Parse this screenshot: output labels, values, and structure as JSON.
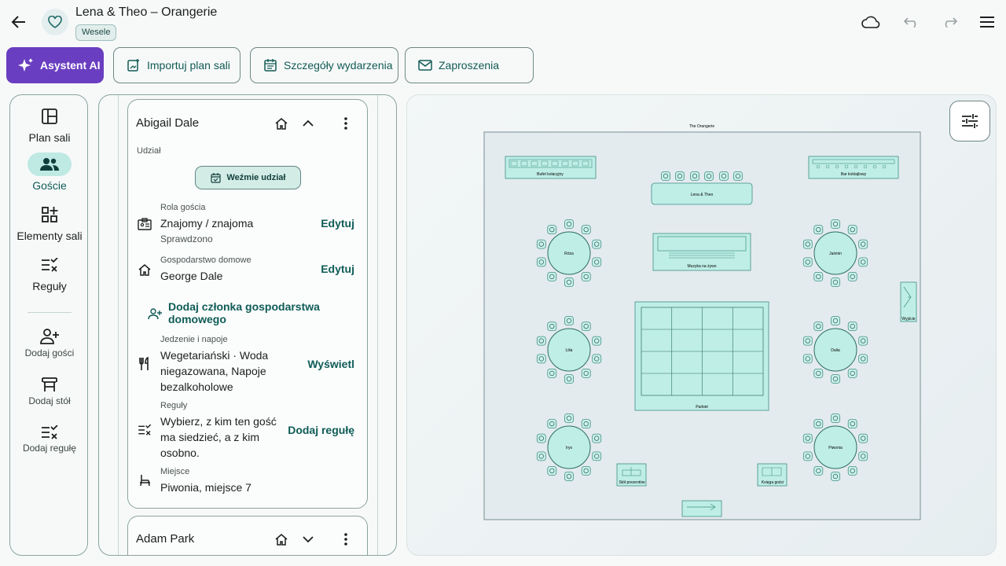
{
  "header": {
    "title": "Lena & Theo – Orangerie",
    "badge": "Wesele"
  },
  "toolbar": {
    "ai_label": "Asystent AI",
    "import_label": "Importuj plan sali",
    "details_label": "Szczegóły wydarzenia",
    "invites_label": "Zaproszenia"
  },
  "rail": {
    "nav": [
      {
        "label": "Plan sali",
        "icon": "layout-icon"
      },
      {
        "label": "Goście",
        "icon": "people-icon"
      },
      {
        "label": "Elementy sali",
        "icon": "widgets-icon"
      },
      {
        "label": "Reguły",
        "icon": "rules-icon"
      }
    ],
    "actions": [
      {
        "label": "Dodaj gości",
        "icon": "add-person-icon"
      },
      {
        "label": "Dodaj stół",
        "icon": "table-icon"
      },
      {
        "label": "Dodaj regułę",
        "icon": "rules-icon"
      }
    ]
  },
  "guest": {
    "name": "Abigail Dale",
    "participation_label": "Udział",
    "participation_btn": "Weźmie udział",
    "role_label": "Rola gościa",
    "role_value": "Znajomy / znajoma",
    "role_status": "Sprawdzono",
    "role_action": "Edytuj",
    "household_label": "Gospodarstwo domowe",
    "household_value": "George Dale",
    "household_action": "Edytuj",
    "add_member": "Dodaj członka gospodarstwa domowego",
    "food_label": "Jedzenie i napoje",
    "food_value": "Wegetariański · Woda niegazowana, Napoje bezalkoholowe",
    "food_action": "Wyświetl",
    "rules_label": "Reguły",
    "rules_value": "Wybierz, z kim ten gość ma siedzieć, a z kim osobno.",
    "rules_action": "Dodaj regułę",
    "seat_label": "Miejsce",
    "seat_value": "Piwonia, miejsce 7"
  },
  "guest2": {
    "name": "Adam Park"
  },
  "map": {
    "venue": "The Orangerie",
    "cake_table": "Bufet kolacyjny",
    "head_table": "Lena & Theo",
    "bar": "Bar koktajlowy",
    "music": "Muzyka na żywo",
    "dance": "Parkiet",
    "exit": "Wyjście",
    "gifts": "Stół prezentów",
    "guestbook": "Księga gości",
    "tables": [
      "Róża",
      "Jaśmin",
      "Lilia",
      "Dalia",
      "Irys",
      "Piwonia"
    ]
  },
  "colors": {
    "accent": "#6a3ec0",
    "primary": "#0f5c57",
    "table_fill": "#bfeee6"
  }
}
